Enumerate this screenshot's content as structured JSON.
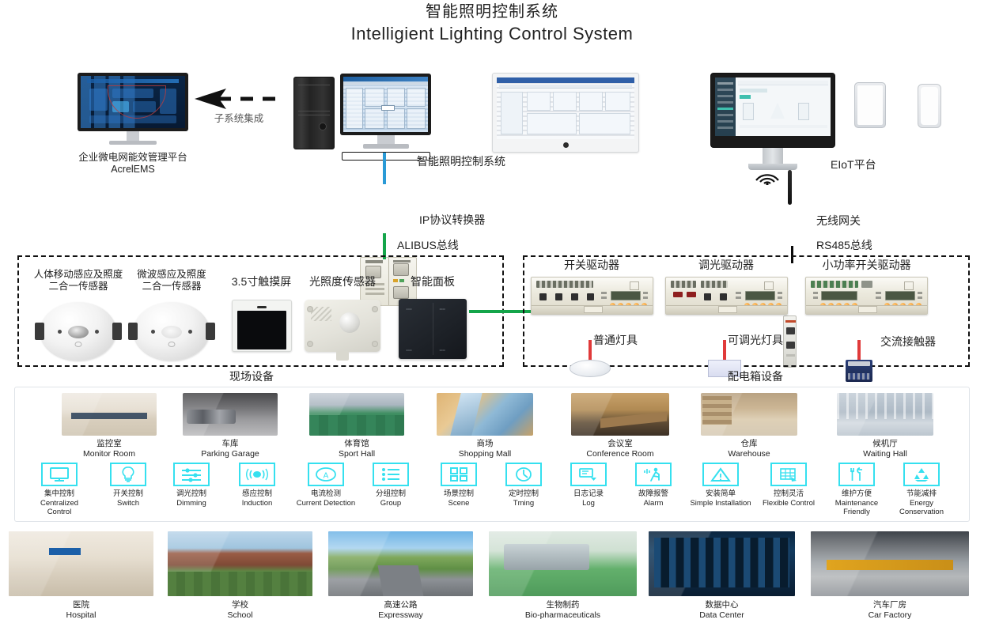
{
  "title": {
    "cn": "智能照明控制系统",
    "en": "Intelligient Lighting Control System"
  },
  "top_systems": {
    "ems": {
      "label_cn": "企业微电网能效管理平台",
      "label_en": "AcrelEMS",
      "integration_note": "子系统集成"
    },
    "lighting_workstation": {
      "label": "智能照明控制系统"
    },
    "eiot": {
      "label": "EIoT平台"
    }
  },
  "network": {
    "ip_converter": "IP协议转换器",
    "alibus": "ALIBUS总线",
    "wireless_gateway": "无线网关",
    "rs485": "RS485总线"
  },
  "field_devices": {
    "group_label": "现场设备",
    "items": [
      {
        "name": "人体移动感应及照度\n二合一传感器",
        "line1": "人体移动感应及照度",
        "line2": "二合一传感器",
        "icon": "pir-illuminance-sensor-icon"
      },
      {
        "name": "微波感应及照度\n二合一传感器",
        "line1": "微波感应及照度",
        "line2": "二合一传感器",
        "icon": "microwave-illuminance-sensor-icon"
      },
      {
        "name": "3.5寸触摸屏",
        "line1": "3.5寸触摸屏",
        "line2": "",
        "icon": "touch-screen-icon"
      },
      {
        "name": "光照度传感器",
        "line1": "光照度传感器",
        "line2": "",
        "icon": "illuminance-sensor-icon"
      },
      {
        "name": "智能面板",
        "line1": "智能面板",
        "line2": "",
        "icon": "smart-panel-icon"
      }
    ]
  },
  "panel_devices": {
    "group_label": "配电箱设备",
    "items": [
      {
        "driver": "开关驱动器",
        "load": "普通灯具",
        "load_icon": "round-lamp-icon"
      },
      {
        "driver": "调光驱动器",
        "load": "可调光灯具",
        "load_icon": "dimmable-panel-lamp-icon"
      },
      {
        "driver": "小功率开关驱动器",
        "load": "交流接触器",
        "load_icon": "ac-contactor-icon"
      }
    ]
  },
  "scenarios": [
    {
      "cn": "监控室",
      "en": "Monitor Room",
      "photo": "monitor-room-photo"
    },
    {
      "cn": "车库",
      "en": "Parking Garage",
      "photo": "parking-garage-photo"
    },
    {
      "cn": "体育馆",
      "en": "Sport Hall",
      "photo": "sport-hall-photo"
    },
    {
      "cn": "商场",
      "en": "Shopping Mall",
      "photo": "shopping-mall-photo"
    },
    {
      "cn": "会议室",
      "en": "Conference Room",
      "photo": "conference-room-photo"
    },
    {
      "cn": "仓库",
      "en": "Warehouse",
      "photo": "warehouse-photo"
    },
    {
      "cn": "候机厅",
      "en": "Waiting Hall",
      "photo": "waiting-hall-photo"
    }
  ],
  "features": [
    {
      "cn": "集中控制",
      "en": "Centralized Control",
      "icon": "monitor-icon"
    },
    {
      "cn": "开关控制",
      "en": "Switch",
      "icon": "bulb-icon"
    },
    {
      "cn": "调光控制",
      "en": "Dimming",
      "icon": "sliders-icon"
    },
    {
      "cn": "感应控制",
      "en": "Induction",
      "icon": "sensor-wave-icon"
    },
    {
      "cn": "电流检测",
      "en": "Current Detection",
      "icon": "ammeter-icon"
    },
    {
      "cn": "分组控制",
      "en": "Group",
      "icon": "list-icon"
    },
    {
      "cn": "场景控制",
      "en": "Scene",
      "icon": "grid-blocks-icon"
    },
    {
      "cn": "定时控制",
      "en": "Tming",
      "icon": "clock-icon"
    },
    {
      "cn": "日志记录",
      "en": "Log",
      "icon": "log-save-icon"
    },
    {
      "cn": "故障报警",
      "en": "Alarm",
      "icon": "alarm-running-man-icon"
    },
    {
      "cn": "安装简单",
      "en": "Simple Installation",
      "icon": "triangle-install-icon"
    },
    {
      "cn": "控制灵活",
      "en": "Flexible Control",
      "icon": "table-arrow-icon"
    },
    {
      "cn": "维护方便",
      "en": "Maintenance Friendly",
      "icon": "tools-icon"
    },
    {
      "cn": "节能减排",
      "en": "Energy Conservation",
      "icon": "recycle-icon"
    }
  ],
  "industries": [
    {
      "cn": "医院",
      "en": "Hospital",
      "photo": "hospital-photo"
    },
    {
      "cn": "学校",
      "en": "School",
      "photo": "school-photo"
    },
    {
      "cn": "高速公路",
      "en": "Expressway",
      "photo": "expressway-photo"
    },
    {
      "cn": "生物制药",
      "en": "Bio-pharmaceuticals",
      "photo": "bio-pharmaceuticals-photo"
    },
    {
      "cn": "数据中心",
      "en": "Data Center",
      "photo": "data-center-photo"
    },
    {
      "cn": "汽车厂房",
      "en": "Car Factory",
      "photo": "car-factory-photo"
    }
  ],
  "colors": {
    "bus_green": "#14a54a",
    "bus_blue": "#2a9ad6",
    "load_red": "#e03a3a",
    "feature_cyan": "#35e0ef",
    "text": "#222222"
  }
}
